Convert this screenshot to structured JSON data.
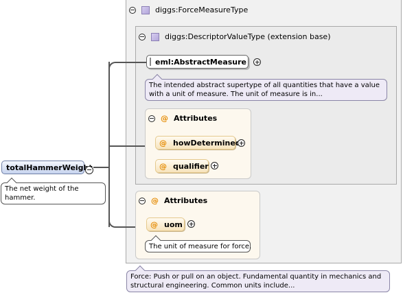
{
  "root_element": {
    "name": "totalHammerWeight",
    "doc": "The net weight of the hammer."
  },
  "force_measure_type": {
    "name": "diggs:ForceMeasureType",
    "doc": "Force: Push or pull on an object. Fundamental quantity in mechanics and structural engineering. Common units include...",
    "descriptor_value_type": {
      "name": "diggs:DescriptorValueType (extension base)",
      "abstract_measure": {
        "name": "eml:AbstractMeasure",
        "doc": "The intended abstract supertype of all quantities that have a value with a unit of measure. The unit of measure is in..."
      },
      "attributes": {
        "label": "Attributes",
        "items": [
          {
            "name": "howDetermined"
          },
          {
            "name": "qualifier"
          }
        ]
      }
    },
    "attributes": {
      "label": "Attributes",
      "items": [
        {
          "name": "uom",
          "doc": "The unit of measure for force."
        }
      ]
    }
  },
  "symbols": {
    "at": "@"
  },
  "colors": {
    "type_background": "#f1f1f1",
    "attribute_background": "#fdf8ee",
    "root_node_gradient": "#c6d3ee",
    "attribute_node_border": "#e5c98d"
  }
}
